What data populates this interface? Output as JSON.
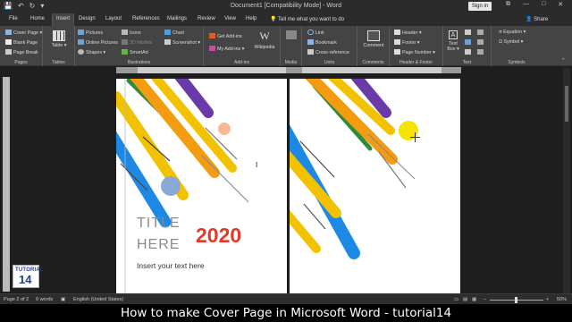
{
  "window": {
    "title": "Document1 [Compatibility Mode] - Word",
    "sign_in": "Sign in",
    "qat": {
      "save": "💾",
      "undo": "↶",
      "redo": "↻",
      "more": "▾"
    },
    "controls": {
      "restore": "⧉",
      "minimize": "—",
      "maximize": "□",
      "close": "✕"
    }
  },
  "tabs": [
    "File",
    "Home",
    "Insert",
    "Design",
    "Layout",
    "References",
    "Mailings",
    "Review",
    "View",
    "Help"
  ],
  "active_tab": "Insert",
  "tell_me": "Tell me what you want to do",
  "share": "Share",
  "ribbon": {
    "pages": {
      "label": "Pages",
      "items": [
        "Cover Page ▾",
        "Blank Page",
        "Page Break"
      ]
    },
    "tables": {
      "label": "Tables",
      "table": "Table ▾"
    },
    "illustrations": {
      "label": "Illustrations",
      "pictures": "Pictures",
      "online_pictures": "Online Pictures",
      "shapes": "Shapes ▾",
      "icons": "Icons",
      "models": "3D Models",
      "smartart": "SmartArt",
      "chart": "Chart",
      "screenshot": "Screenshot ▾"
    },
    "addins": {
      "label": "Add-ins",
      "get": "Get Add-ins",
      "my": "My Add-ins ▾",
      "wikipedia": "Wikipedia"
    },
    "media": {
      "label": "Media",
      "online_video": "Online Video"
    },
    "links": {
      "label": "Links",
      "link": "Link",
      "bookmark": "Bookmark",
      "cross_ref": "Cross-reference"
    },
    "comments": {
      "label": "Comments",
      "comment": "Comment"
    },
    "header_footer": {
      "label": "Header & Footer",
      "header": "Header ▾",
      "footer": "Footer ▾",
      "page_number": "Page Number ▾"
    },
    "text": {
      "label": "Text",
      "text_box": "Text Box ▾"
    },
    "symbols": {
      "label": "Symbols",
      "equation": "Equation ▾",
      "symbol": "Symbol ▾"
    }
  },
  "cover": {
    "title_line1": "TITLE",
    "title_line2": "HERE",
    "year": "2020",
    "subtitle": "Insert your text here"
  },
  "logo": {
    "line1": "TUTORIAL",
    "line2": "14"
  },
  "status": {
    "page": "Page 2 of 2",
    "words": "0 words",
    "language": "English (United States)",
    "zoom": "50%",
    "zoom_minus": "−",
    "zoom_plus": "+"
  },
  "caption": "How to make Cover Page in Microsoft Word - tutorial14",
  "colors": {
    "purple": "#6a3aa8",
    "green": "#2e8b3a",
    "yellow": "#f2c200",
    "orange": "#f39c12",
    "blue": "#1e88e5",
    "year_red": "#e03a2a"
  }
}
